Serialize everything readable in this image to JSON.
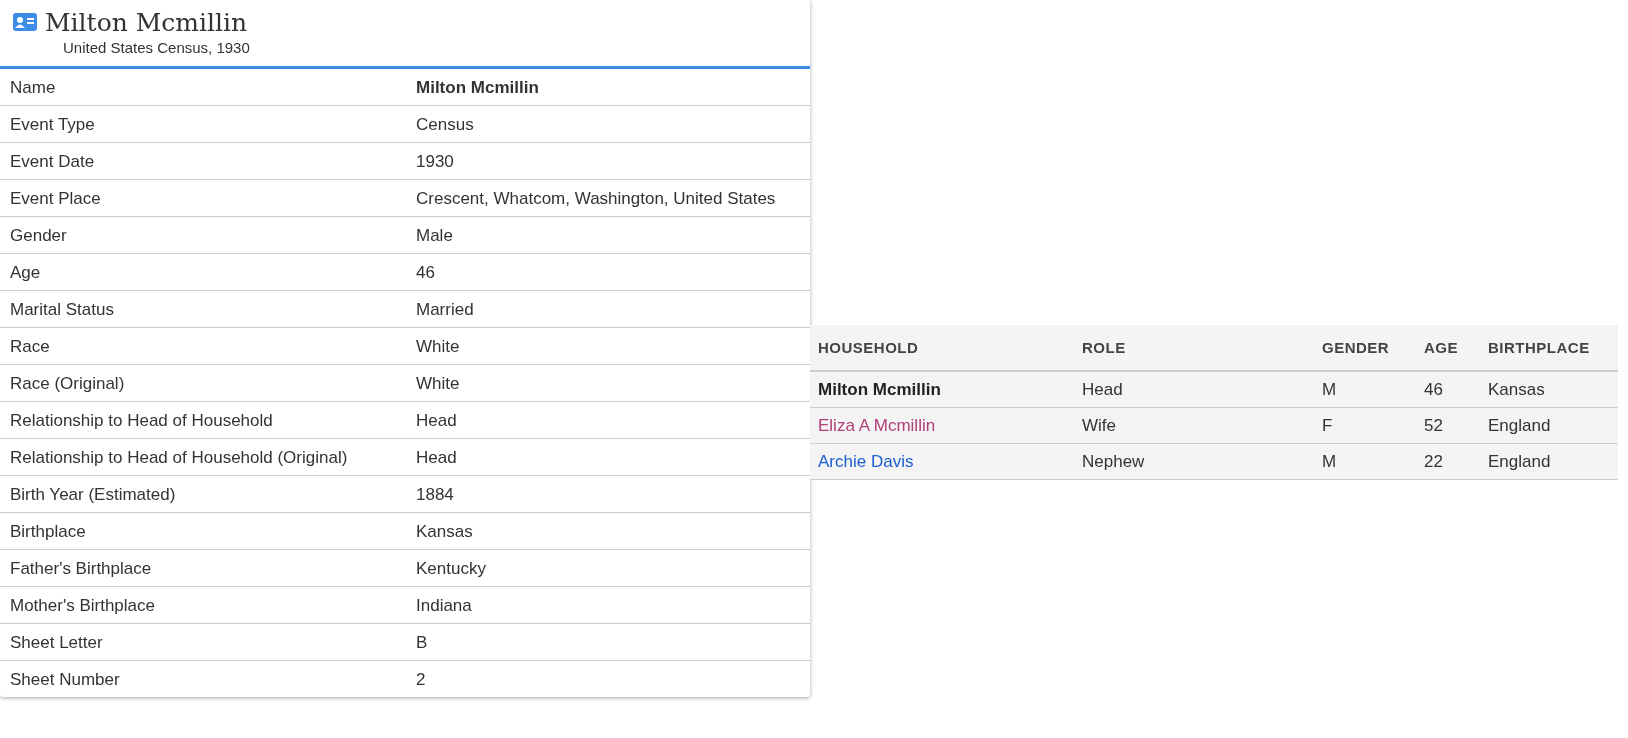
{
  "record": {
    "title": "Milton Mcmillin",
    "subtitle": "United States Census, 1930",
    "fields": [
      {
        "label": "Name",
        "value": "Milton Mcmillin",
        "kind": "emphasis"
      },
      {
        "label": "Event Type",
        "value": "Census",
        "kind": "plain"
      },
      {
        "label": "Event Date",
        "value": "1930",
        "kind": "plain"
      },
      {
        "label": "Event Place",
        "value": "Crescent, Whatcom, Washington, United States",
        "kind": "plain"
      },
      {
        "label": "Gender",
        "value": "Male",
        "kind": "plain"
      },
      {
        "label": "Age",
        "value": "46",
        "kind": "plain"
      },
      {
        "label": "Marital Status",
        "value": "Married",
        "kind": "plain"
      },
      {
        "label": "Race",
        "value": "White",
        "kind": "plain"
      },
      {
        "label": "Race (Original)",
        "value": "White",
        "kind": "plain"
      },
      {
        "label": "Relationship to Head of Household",
        "value": "Head",
        "kind": "plain"
      },
      {
        "label": "Relationship to Head of Household (Original)",
        "value": "Head",
        "kind": "plain"
      },
      {
        "label": "Birth Year (Estimated)",
        "value": "1884",
        "kind": "plain"
      },
      {
        "label": "Birthplace",
        "value": "Kansas",
        "kind": "plain"
      },
      {
        "label": "Father's Birthplace",
        "value": "Kentucky",
        "kind": "plain"
      },
      {
        "label": "Mother's Birthplace",
        "value": "Indiana",
        "kind": "plain"
      },
      {
        "label": "Sheet Letter",
        "value": "B",
        "kind": "plain"
      },
      {
        "label": "Sheet Number",
        "value": "2",
        "kind": "plain"
      }
    ]
  },
  "household": {
    "columns": [
      "HOUSEHOLD",
      "ROLE",
      "GENDER",
      "AGE",
      "BIRTHPLACE"
    ],
    "rows": [
      {
        "name": "Milton Mcmillin",
        "kind": "current",
        "role": "Head",
        "gender": "M",
        "age": "46",
        "birthplace": "Kansas"
      },
      {
        "name": "Eliza A Mcmillin",
        "kind": "link",
        "color": "#b0407a",
        "role": "Wife",
        "gender": "F",
        "age": "52",
        "birthplace": "England"
      },
      {
        "name": "Archie Davis",
        "kind": "link",
        "color": "#1a5fd0",
        "role": "Nephew",
        "gender": "M",
        "age": "22",
        "birthplace": "England"
      }
    ]
  }
}
